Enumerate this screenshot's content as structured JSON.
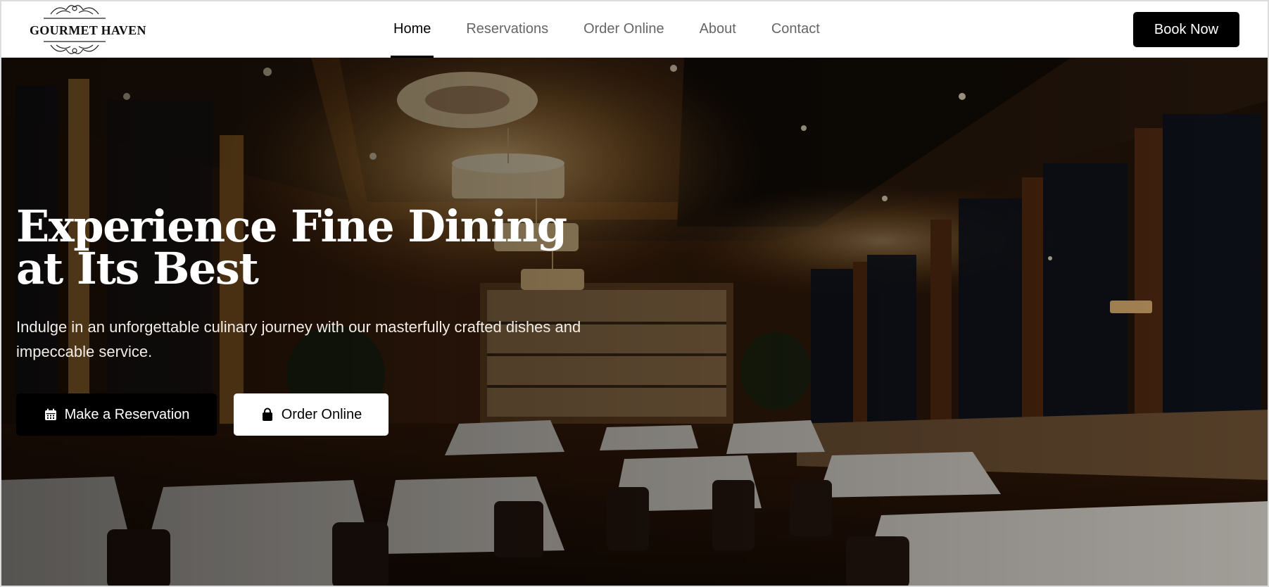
{
  "brand": {
    "name": "GOURMET HAVEN"
  },
  "nav": {
    "items": [
      {
        "label": "Home",
        "active": true
      },
      {
        "label": "Reservations",
        "active": false
      },
      {
        "label": "Order Online",
        "active": false
      },
      {
        "label": "About",
        "active": false
      },
      {
        "label": "Contact",
        "active": false
      }
    ],
    "cta_label": "Book Now"
  },
  "hero": {
    "title": "Experience Fine Dining at Its Best",
    "subtitle": "Indulge in an unforgettable culinary journey with our masterfully crafted dishes and impeccable service.",
    "primary_button": {
      "label": "Make a Reservation",
      "icon": "calendar-icon"
    },
    "secondary_button": {
      "label": "Order Online",
      "icon": "shopping-bag-icon"
    }
  },
  "colors": {
    "primary": "#000000",
    "background": "#ffffff",
    "nav_inactive": "#666666",
    "hero_overlay": "#1c0f06"
  }
}
